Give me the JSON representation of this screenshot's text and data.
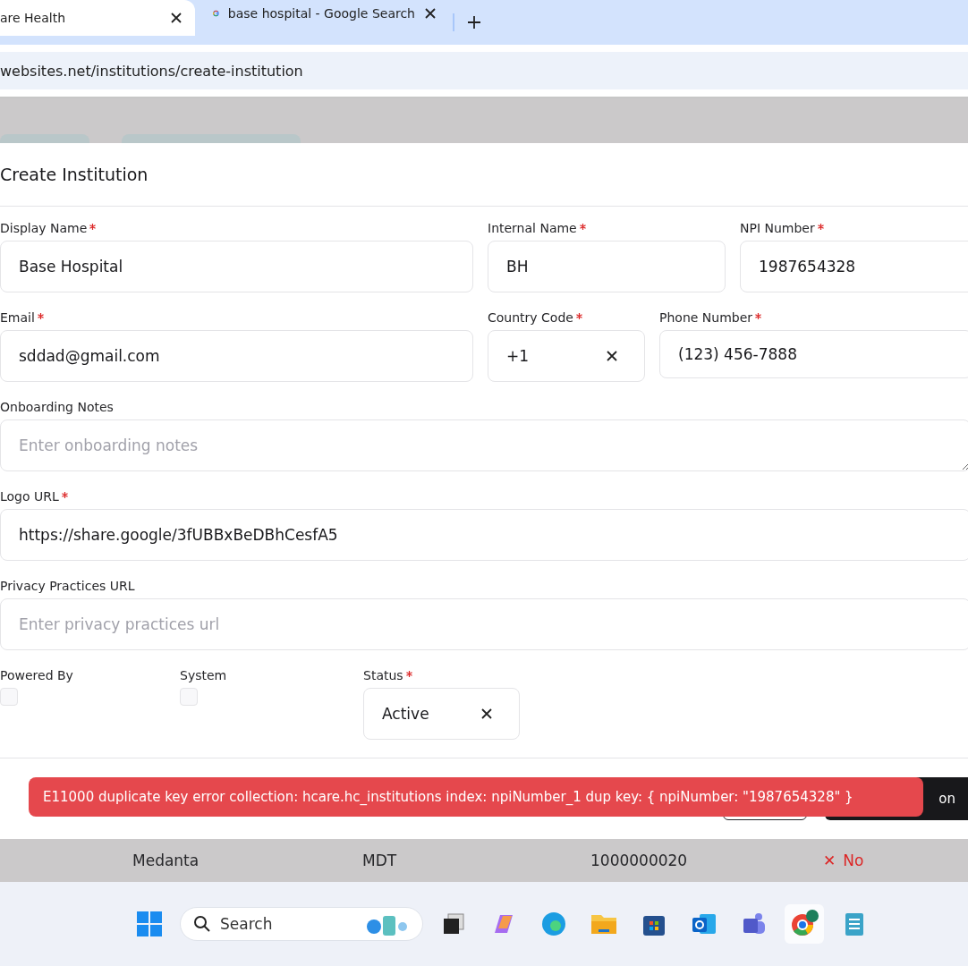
{
  "browser": {
    "tabs": [
      {
        "title": "are Health",
        "selected": true
      },
      {
        "title": "base hospital - Google Search",
        "selected": false
      }
    ],
    "address": "websites.net/institutions/create-institution"
  },
  "modal": {
    "title": "Create Institution",
    "rows": [
      [
        {
          "label": "Display Name",
          "required": true,
          "value": "Base Hospital",
          "kind": "input"
        },
        {
          "label": "Internal Name",
          "required": true,
          "value": "BH",
          "kind": "input"
        },
        {
          "label": "NPI Number",
          "required": true,
          "value": "1987654328",
          "kind": "input"
        }
      ],
      [
        {
          "label": "Email",
          "required": true,
          "value": "sddad@gmail.com",
          "kind": "input"
        },
        {
          "label": "Country Code",
          "required": true,
          "value": "+1",
          "kind": "select"
        },
        {
          "label": "Phone Number",
          "required": true,
          "value": "(123) 456-7888",
          "kind": "input"
        }
      ],
      [
        {
          "label": "Onboarding Notes",
          "required": false,
          "placeholder": "Enter onboarding notes",
          "kind": "textarea"
        }
      ],
      [
        {
          "label": "Logo URL",
          "required": true,
          "value": "https://share.google/3fUBBxBeDBhCesfA5",
          "kind": "input"
        }
      ],
      [
        {
          "label": "Privacy Practices URL",
          "required": false,
          "placeholder": "Enter privacy practices url",
          "kind": "input"
        }
      ]
    ],
    "checkboxes": [
      {
        "label": "Powered By",
        "checked": false
      },
      {
        "label": "System",
        "checked": false
      }
    ],
    "status": {
      "label": "Status",
      "required": true,
      "value": "Active"
    },
    "footer_buttons": [
      {
        "label": "on",
        "kind": "primary"
      }
    ]
  },
  "toast": {
    "message": "E11000 duplicate key error collection: hcare.hc_institutions index: npiNumber_1 dup key: { npiNumber: \"1987654328\" }"
  },
  "table_row": {
    "cells": [
      "Medanta",
      "MDT",
      "1000000020"
    ],
    "flag": {
      "icon": "✕",
      "text": "No"
    }
  },
  "taskbar": {
    "search": "Search"
  }
}
